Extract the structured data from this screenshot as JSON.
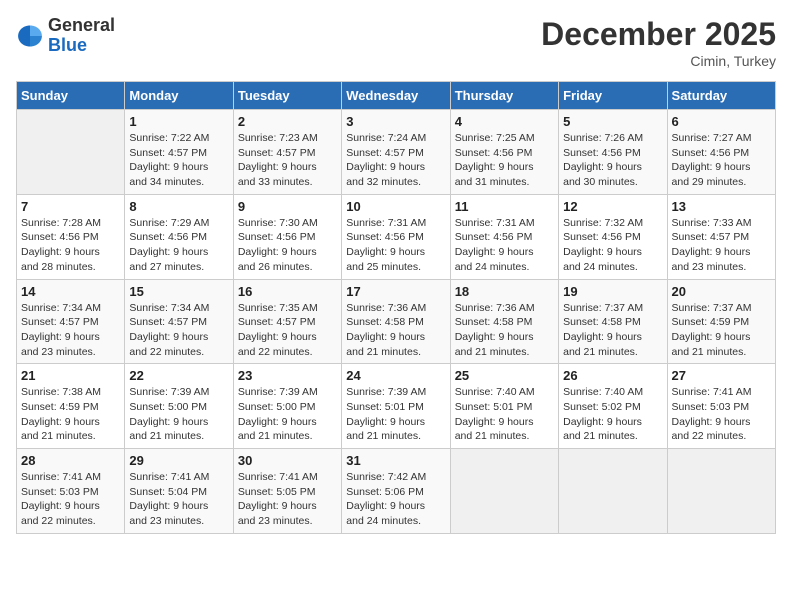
{
  "header": {
    "logo_line1": "General",
    "logo_line2": "Blue",
    "month": "December 2025",
    "location": "Cimin, Turkey"
  },
  "weekdays": [
    "Sunday",
    "Monday",
    "Tuesday",
    "Wednesday",
    "Thursday",
    "Friday",
    "Saturday"
  ],
  "weeks": [
    [
      {
        "day": "",
        "info": ""
      },
      {
        "day": "1",
        "info": "Sunrise: 7:22 AM\nSunset: 4:57 PM\nDaylight: 9 hours\nand 34 minutes."
      },
      {
        "day": "2",
        "info": "Sunrise: 7:23 AM\nSunset: 4:57 PM\nDaylight: 9 hours\nand 33 minutes."
      },
      {
        "day": "3",
        "info": "Sunrise: 7:24 AM\nSunset: 4:57 PM\nDaylight: 9 hours\nand 32 minutes."
      },
      {
        "day": "4",
        "info": "Sunrise: 7:25 AM\nSunset: 4:56 PM\nDaylight: 9 hours\nand 31 minutes."
      },
      {
        "day": "5",
        "info": "Sunrise: 7:26 AM\nSunset: 4:56 PM\nDaylight: 9 hours\nand 30 minutes."
      },
      {
        "day": "6",
        "info": "Sunrise: 7:27 AM\nSunset: 4:56 PM\nDaylight: 9 hours\nand 29 minutes."
      }
    ],
    [
      {
        "day": "7",
        "info": "Sunrise: 7:28 AM\nSunset: 4:56 PM\nDaylight: 9 hours\nand 28 minutes."
      },
      {
        "day": "8",
        "info": "Sunrise: 7:29 AM\nSunset: 4:56 PM\nDaylight: 9 hours\nand 27 minutes."
      },
      {
        "day": "9",
        "info": "Sunrise: 7:30 AM\nSunset: 4:56 PM\nDaylight: 9 hours\nand 26 minutes."
      },
      {
        "day": "10",
        "info": "Sunrise: 7:31 AM\nSunset: 4:56 PM\nDaylight: 9 hours\nand 25 minutes."
      },
      {
        "day": "11",
        "info": "Sunrise: 7:31 AM\nSunset: 4:56 PM\nDaylight: 9 hours\nand 24 minutes."
      },
      {
        "day": "12",
        "info": "Sunrise: 7:32 AM\nSunset: 4:56 PM\nDaylight: 9 hours\nand 24 minutes."
      },
      {
        "day": "13",
        "info": "Sunrise: 7:33 AM\nSunset: 4:57 PM\nDaylight: 9 hours\nand 23 minutes."
      }
    ],
    [
      {
        "day": "14",
        "info": "Sunrise: 7:34 AM\nSunset: 4:57 PM\nDaylight: 9 hours\nand 23 minutes."
      },
      {
        "day": "15",
        "info": "Sunrise: 7:34 AM\nSunset: 4:57 PM\nDaylight: 9 hours\nand 22 minutes."
      },
      {
        "day": "16",
        "info": "Sunrise: 7:35 AM\nSunset: 4:57 PM\nDaylight: 9 hours\nand 22 minutes."
      },
      {
        "day": "17",
        "info": "Sunrise: 7:36 AM\nSunset: 4:58 PM\nDaylight: 9 hours\nand 21 minutes."
      },
      {
        "day": "18",
        "info": "Sunrise: 7:36 AM\nSunset: 4:58 PM\nDaylight: 9 hours\nand 21 minutes."
      },
      {
        "day": "19",
        "info": "Sunrise: 7:37 AM\nSunset: 4:58 PM\nDaylight: 9 hours\nand 21 minutes."
      },
      {
        "day": "20",
        "info": "Sunrise: 7:37 AM\nSunset: 4:59 PM\nDaylight: 9 hours\nand 21 minutes."
      }
    ],
    [
      {
        "day": "21",
        "info": "Sunrise: 7:38 AM\nSunset: 4:59 PM\nDaylight: 9 hours\nand 21 minutes."
      },
      {
        "day": "22",
        "info": "Sunrise: 7:39 AM\nSunset: 5:00 PM\nDaylight: 9 hours\nand 21 minutes."
      },
      {
        "day": "23",
        "info": "Sunrise: 7:39 AM\nSunset: 5:00 PM\nDaylight: 9 hours\nand 21 minutes."
      },
      {
        "day": "24",
        "info": "Sunrise: 7:39 AM\nSunset: 5:01 PM\nDaylight: 9 hours\nand 21 minutes."
      },
      {
        "day": "25",
        "info": "Sunrise: 7:40 AM\nSunset: 5:01 PM\nDaylight: 9 hours\nand 21 minutes."
      },
      {
        "day": "26",
        "info": "Sunrise: 7:40 AM\nSunset: 5:02 PM\nDaylight: 9 hours\nand 21 minutes."
      },
      {
        "day": "27",
        "info": "Sunrise: 7:41 AM\nSunset: 5:03 PM\nDaylight: 9 hours\nand 22 minutes."
      }
    ],
    [
      {
        "day": "28",
        "info": "Sunrise: 7:41 AM\nSunset: 5:03 PM\nDaylight: 9 hours\nand 22 minutes."
      },
      {
        "day": "29",
        "info": "Sunrise: 7:41 AM\nSunset: 5:04 PM\nDaylight: 9 hours\nand 23 minutes."
      },
      {
        "day": "30",
        "info": "Sunrise: 7:41 AM\nSunset: 5:05 PM\nDaylight: 9 hours\nand 23 minutes."
      },
      {
        "day": "31",
        "info": "Sunrise: 7:42 AM\nSunset: 5:06 PM\nDaylight: 9 hours\nand 24 minutes."
      },
      {
        "day": "",
        "info": ""
      },
      {
        "day": "",
        "info": ""
      },
      {
        "day": "",
        "info": ""
      }
    ]
  ]
}
